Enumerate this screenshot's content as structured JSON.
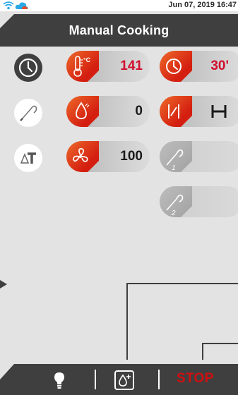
{
  "status_bar": {
    "datetime": "Jun 07, 2019 16:47",
    "icons": [
      "wifi-icon",
      "cloud-icon"
    ]
  },
  "header": {
    "title": "Manual Cooking"
  },
  "left_buttons": [
    {
      "icon": "clock-icon"
    },
    {
      "icon": "probe-icon"
    },
    {
      "icon": "delta-t-icon",
      "label": "ΔT"
    }
  ],
  "controls": {
    "temperature": {
      "icon": "thermometer-celsius-icon",
      "value": "141"
    },
    "humidity": {
      "icon": "water-drop-icon",
      "value": "0"
    },
    "fan": {
      "icon": "fan-icon",
      "value": "100"
    },
    "time": {
      "icon": "clock-icon",
      "value": "30'"
    },
    "mode": {
      "icon": "steam-vent-icon",
      "value": "H"
    },
    "probe_1": {
      "icon": "probe-1-icon",
      "label": "1"
    },
    "probe_2": {
      "icon": "probe-2-icon",
      "label": "2"
    }
  },
  "bottom_bar": {
    "light_button": {
      "icon": "light-bulb-icon"
    },
    "add_water_button": {
      "icon": "water-drop-plus-icon"
    },
    "stop_label": "STOP"
  },
  "colors": {
    "header_bg": "#3f3f3f",
    "background": "#e3e3e3",
    "accent_red": "#d10f2e",
    "accent_orange": "#ee6a2a"
  }
}
